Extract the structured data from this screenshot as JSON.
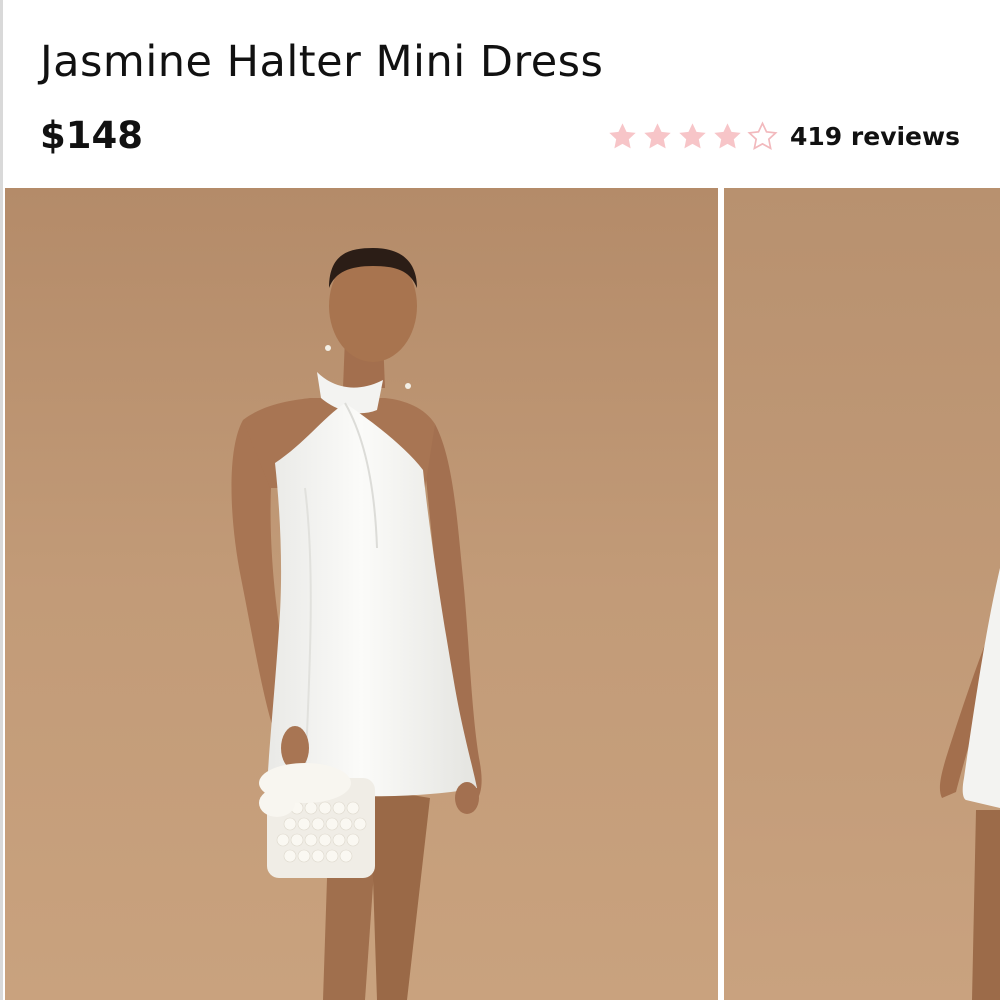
{
  "product": {
    "title": "Jasmine Halter Mini Dress",
    "price": "$148",
    "rating": {
      "value": 4,
      "max": 5,
      "reviews_label": "419 reviews"
    }
  },
  "colors": {
    "star_filled": "#f7c5c8",
    "star_empty_outline": "#f2b9bd",
    "photo_background": "#c39c79",
    "dress": "#f7f7f5"
  },
  "icons": {
    "star_filled": "star-filled-icon",
    "star_empty": "star-outline-icon"
  },
  "gallery": {
    "visible_slides": 2
  }
}
